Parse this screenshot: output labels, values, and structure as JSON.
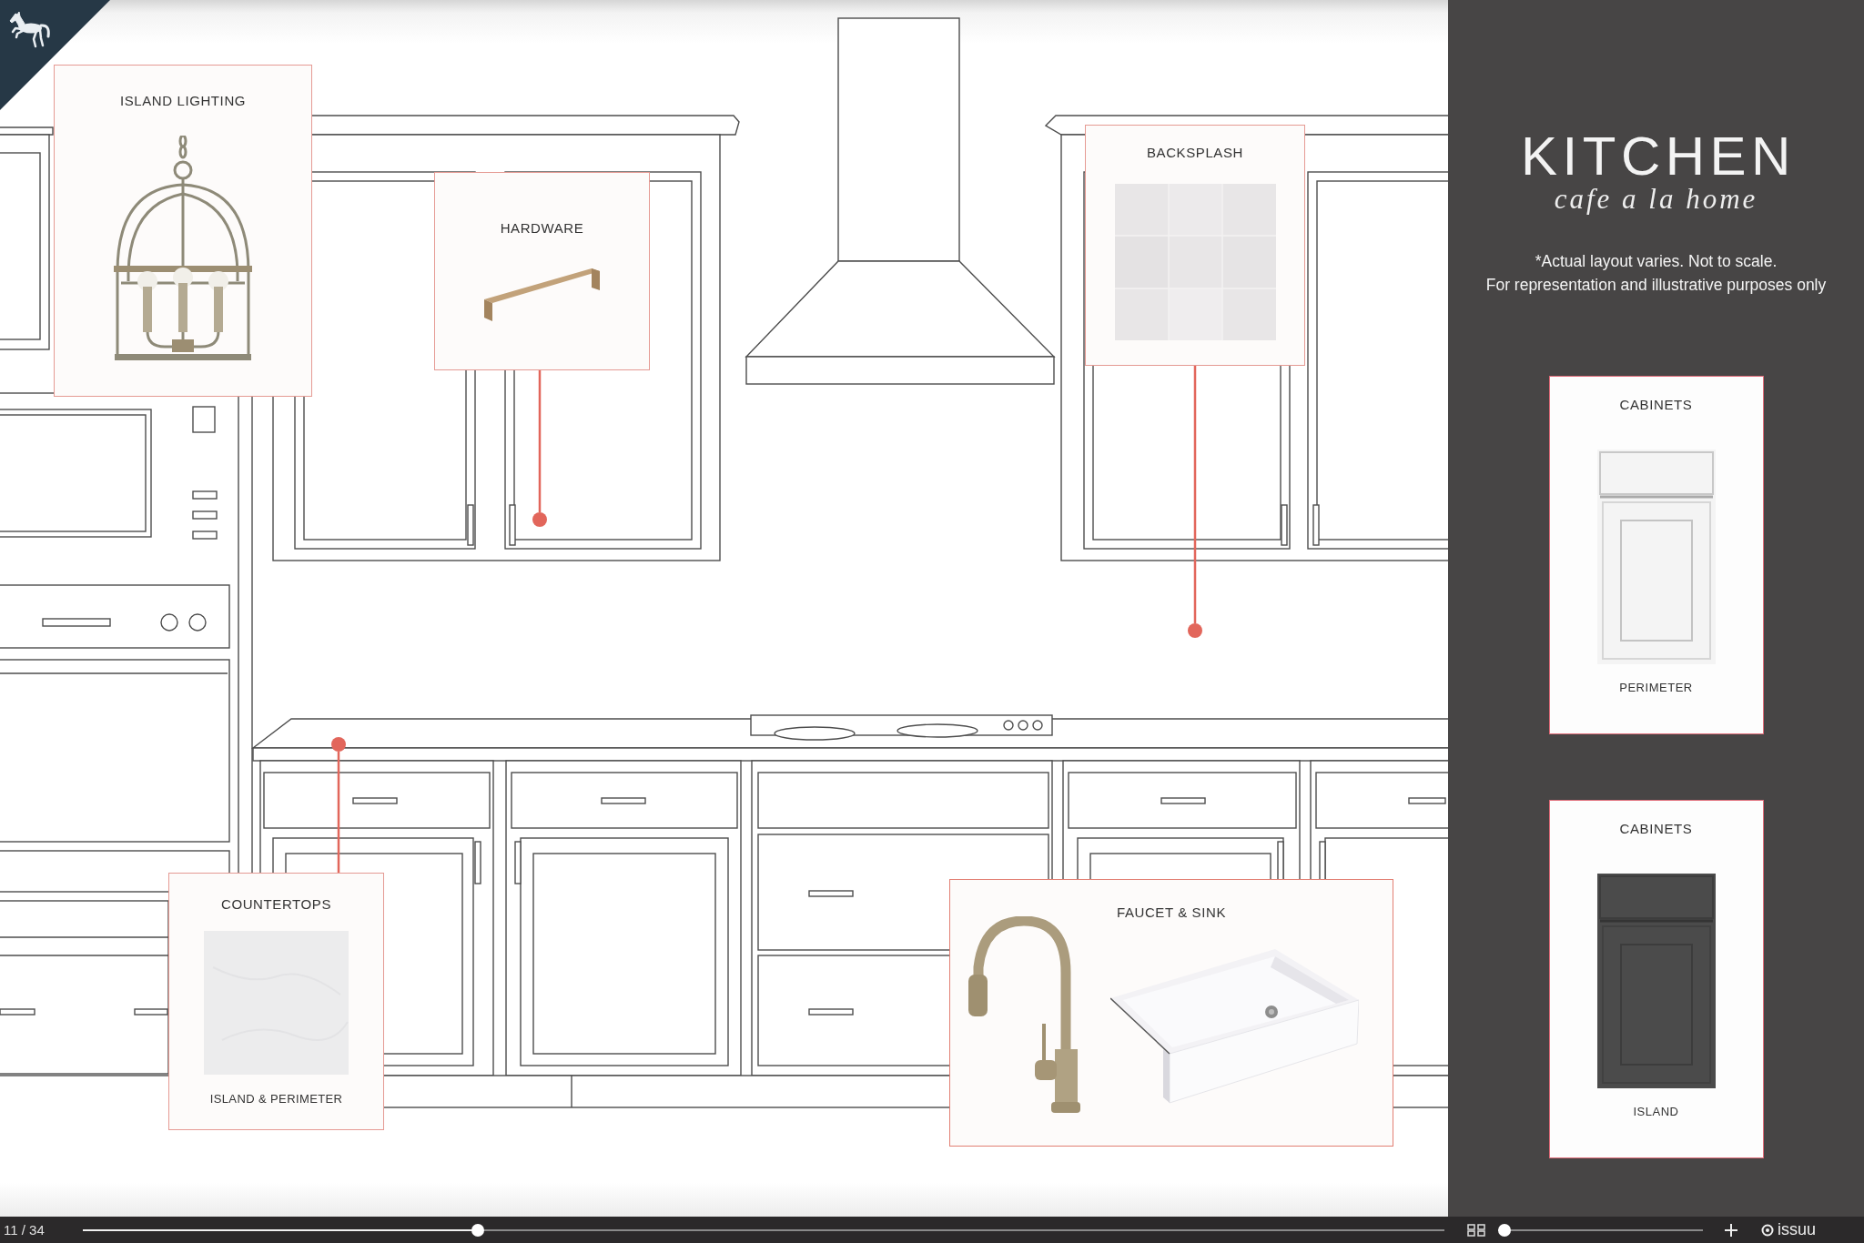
{
  "callouts": [
    {
      "kind": "lighting",
      "title": "ISLAND LIGHTING"
    },
    {
      "kind": "hardware",
      "title": "HARDWARE"
    },
    {
      "kind": "tile",
      "title": "BACKSPLASH"
    },
    {
      "kind": "stone",
      "title": "COUNTERTOPS",
      "caption": "ISLAND & PERIMETER"
    },
    {
      "kind": "plumbing",
      "title": "FAUCET & SINK"
    }
  ],
  "panel": {
    "title": "KITCHEN",
    "subtitle": "cafe a la home",
    "note_lines": [
      "*Actual layout varies. Not to scale.",
      "For representation and illustrative purposes only"
    ]
  },
  "cabinet_swatches": [
    {
      "title": "CABINETS",
      "caption": "PERIMETER",
      "color": "#f4f4f4"
    },
    {
      "title": "CABINETS",
      "caption": "ISLAND",
      "color": "#4b4b4b"
    }
  ],
  "viewer_bar": {
    "page_counter": "11 / 34",
    "page_slider": {
      "level": 0.29
    },
    "zoom_slider": {
      "level": 0.03
    },
    "logo_text": "issuu"
  }
}
